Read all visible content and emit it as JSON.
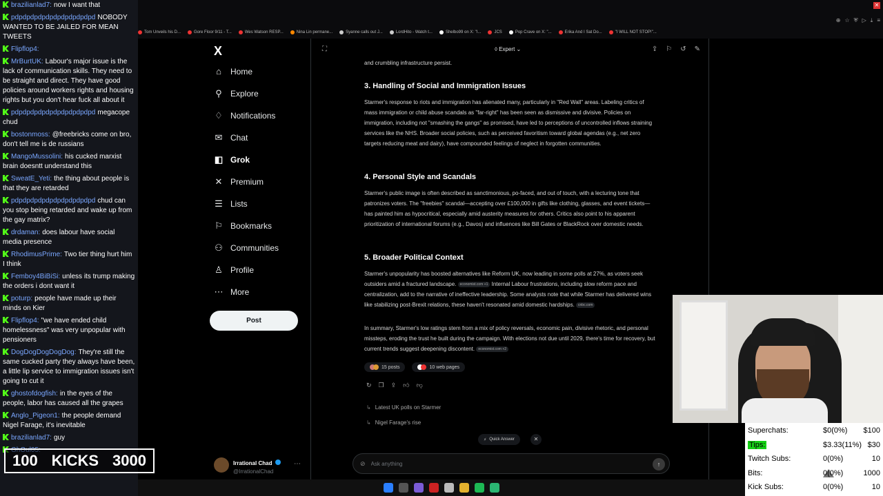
{
  "chat": {
    "messages": [
      {
        "user": "brazilianlad7:",
        "text": "now I want that"
      },
      {
        "user": "pdpdpdpdpdpdpdpdpdpdpd",
        "text": "NOBODY WANTED TO BE JAILED FOR MEAN TWEETS"
      },
      {
        "user": "Flipflop4:",
        "text": ""
      },
      {
        "user": "MrBurtUK:",
        "text": "Labour's major issue is the lack of communication skills. They need to be straight and direct. They have good policies around workers rights and housing rights but you don't hear fuck all about it"
      },
      {
        "user": "pdpdpdpdpdpdpdpdpdpdpd",
        "text": "megacope chud"
      },
      {
        "user": "bostonmoss:",
        "text": "@freebricks come on bro, don't tell me is de russians"
      },
      {
        "user": "MangoMussolini:",
        "text": "his cucked marxist brain doesntt understand this"
      },
      {
        "user": "SweatE_Yeti:",
        "text": "the thing about people is that they are retarded"
      },
      {
        "user": "pdpdpdpdpdpdpdpdpdpdpd",
        "text": "chud can you stop being retarded and wake up from the gay matrix?"
      },
      {
        "user": "drdaman:",
        "text": "does labour have social media presence"
      },
      {
        "user": "RhodimusPrime:",
        "text": "Two tier thing hurt him I think"
      },
      {
        "user": "Femboy4BiBiSi:",
        "text": "unless its trump making the orders i dont want it"
      },
      {
        "user": "poturp:",
        "text": "people have made up their minds on Kier"
      },
      {
        "user": "Flipflop4:",
        "text": "\"we have ended child homelessness\" was very unpopular with pensioners"
      },
      {
        "user": "DogDogDogDogDog:",
        "text": "They're still the same cucked party they always have been, a little lip service to immigration issues isn't going to cut it"
      },
      {
        "user": "ghostofdogfish:",
        "text": "in the eyes of the people, labor has caused all the grapes"
      },
      {
        "user": "Anglo_Pigeon1:",
        "text": "the people demand Nigel Farage, it's inevitable"
      },
      {
        "user": "brazilianlad7:",
        "text": "guy"
      },
      {
        "user": "GhOul05:",
        "text": ""
      }
    ]
  },
  "kicks": {
    "left": "100",
    "label": "KICKS",
    "right": "3000"
  },
  "bookmarks": [
    {
      "label": "Tom Unveils his D...",
      "color": "#e33"
    },
    {
      "label": "Gore Floor 9/11 - T...",
      "color": "#e33"
    },
    {
      "label": "Wes Watson RESP...",
      "color": "#e33"
    },
    {
      "label": "Nina Lin permane...",
      "color": "#f80"
    },
    {
      "label": "Syanne calls out J...",
      "color": "#ccc"
    },
    {
      "label": "LordHito - Watch t...",
      "color": "#ccc"
    },
    {
      "label": "Shelbo99 on X: \"I...",
      "color": "#fff"
    },
    {
      "label": "JCS",
      "color": "#e33"
    },
    {
      "label": "Pop Crave on X: \"...",
      "color": "#fff"
    },
    {
      "label": "Erika And I Sat Do...",
      "color": "#e33"
    },
    {
      "label": "\"I WILL NOT STOP!\"...",
      "color": "#e33"
    }
  ],
  "nav": {
    "items": [
      {
        "label": "Home",
        "icon": "⌂"
      },
      {
        "label": "Explore",
        "icon": "⚲"
      },
      {
        "label": "Notifications",
        "icon": "♢"
      },
      {
        "label": "Chat",
        "icon": "✉"
      },
      {
        "label": "Grok",
        "icon": "◧"
      },
      {
        "label": "Premium",
        "icon": "✕"
      },
      {
        "label": "Lists",
        "icon": "☰"
      },
      {
        "label": "Bookmarks",
        "icon": "⚐"
      },
      {
        "label": "Communities",
        "icon": "⚇"
      },
      {
        "label": "Profile",
        "icon": "♙"
      },
      {
        "label": "More",
        "icon": "⋯"
      }
    ],
    "post_label": "Post",
    "logo": "X"
  },
  "profile": {
    "name": "Irrational Chad",
    "handle": "@IrrationalChad"
  },
  "grok": {
    "mode": "Expert",
    "intro_tail": "and crumbling infrastructure persist.",
    "sections": [
      {
        "heading": "3. Handling of Social and Immigration Issues",
        "body": "Starmer's response to riots and immigration has alienated many, particularly in \"Red Wall\" areas. Labeling critics of mass immigration or child abuse scandals as \"far-right\" has been seen as dismissive and divisive.    Policies on immigration, including not \"smashing the gangs\" as promised, have led to perceptions of uncontrolled inflows straining services like the NHS.    Broader social policies, such as perceived favoritism toward global agendas (e.g., net zero targets reducing meat and dairy), have compounded feelings of neglect in forgotten communities."
      },
      {
        "heading": "4. Personal Style and Scandals",
        "body": "Starmer's public image is often described as sanctimonious, po-faced, and out of touch, with a lecturing tone that patronizes voters.    The \"freebies\" scandal—accepting over £100,000 in gifts like clothing, glasses, and event tickets—has painted him as hypocritical, especially amid austerity measures for others.    Critics also point to his apparent prioritization of international forums (e.g., Davos) and influences like Bill Gates or BlackRock over domestic needs."
      },
      {
        "heading": "5. Broader Political Context",
        "body_a": "Starmer's unpopularity has boosted alternatives like Reform UK, now leading in some polls at 27%, as voters seek outsiders amid a fractured landscape.",
        "cite_a": "economist.com +1",
        "body_b": "Internal Labour frustrations, including slow reform pace and centralization, add to the narrative of ineffective leadership.    Some analysts note that while Starmer has delivered wins like stabilizing post-Brexit relations, these haven't resonated amid domestic hardships.",
        "cite_b": "cnbc.com"
      }
    ],
    "summary": "In summary, Starmer's low ratings stem from a mix of policy reversals, economic pain, divisive rhetoric, and personal missteps, eroding the trust he built during the campaign. With elections not due until 2029, there's time for recovery, but current trends suggest deepening discontent.",
    "summary_cite": "economist.com +2",
    "posts_label": "15 posts",
    "pages_label": "10 web pages",
    "followups": [
      "Latest UK polls on Starmer",
      "Nigel Farage's rise"
    ],
    "quick_answer": "Quick Answer",
    "ask_placeholder": "Ask anything"
  },
  "stats": [
    {
      "label": "Superchats:",
      "value": "$0(0%)",
      "goal": "$100"
    },
    {
      "label": "Tips:",
      "value": "$3.33(11%)",
      "goal": "$30"
    },
    {
      "label": "Twitch Subs:",
      "value": "0(0%)",
      "goal": "10"
    },
    {
      "label": "Bits:",
      "value": "0(0%)",
      "goal": "1000"
    },
    {
      "label": "Kick Subs:",
      "value": "0(0%)",
      "goal": "10"
    }
  ]
}
